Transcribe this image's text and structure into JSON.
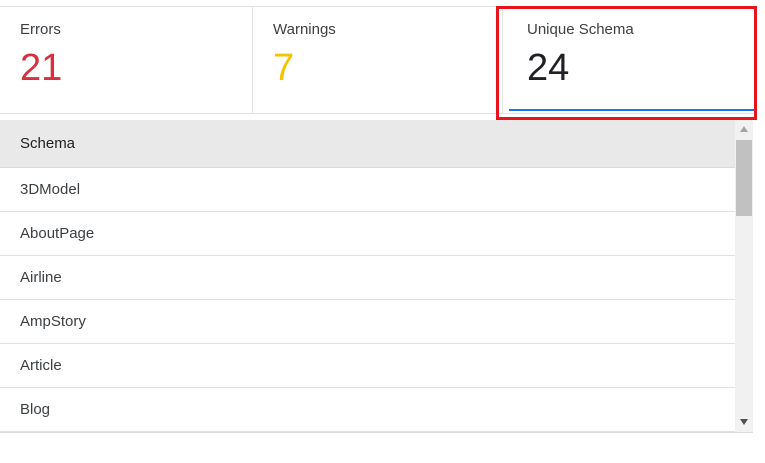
{
  "stats": {
    "errors": {
      "label": "Errors",
      "value": "21"
    },
    "warnings": {
      "label": "Warnings",
      "value": "7"
    },
    "unique_schema": {
      "label": "Unique Schema",
      "value": "24"
    }
  },
  "table": {
    "header": "Schema",
    "rows": [
      "3DModel",
      "AboutPage",
      "Airline",
      "AmpStory",
      "Article",
      "Blog"
    ]
  },
  "colors": {
    "errors": "#d93040",
    "warnings": "#f5c400",
    "active_underline": "#1a73e8",
    "highlight": "#e8141c"
  },
  "icons": {
    "scroll_up": "triangle-up-icon",
    "scroll_down": "triangle-down-icon"
  }
}
